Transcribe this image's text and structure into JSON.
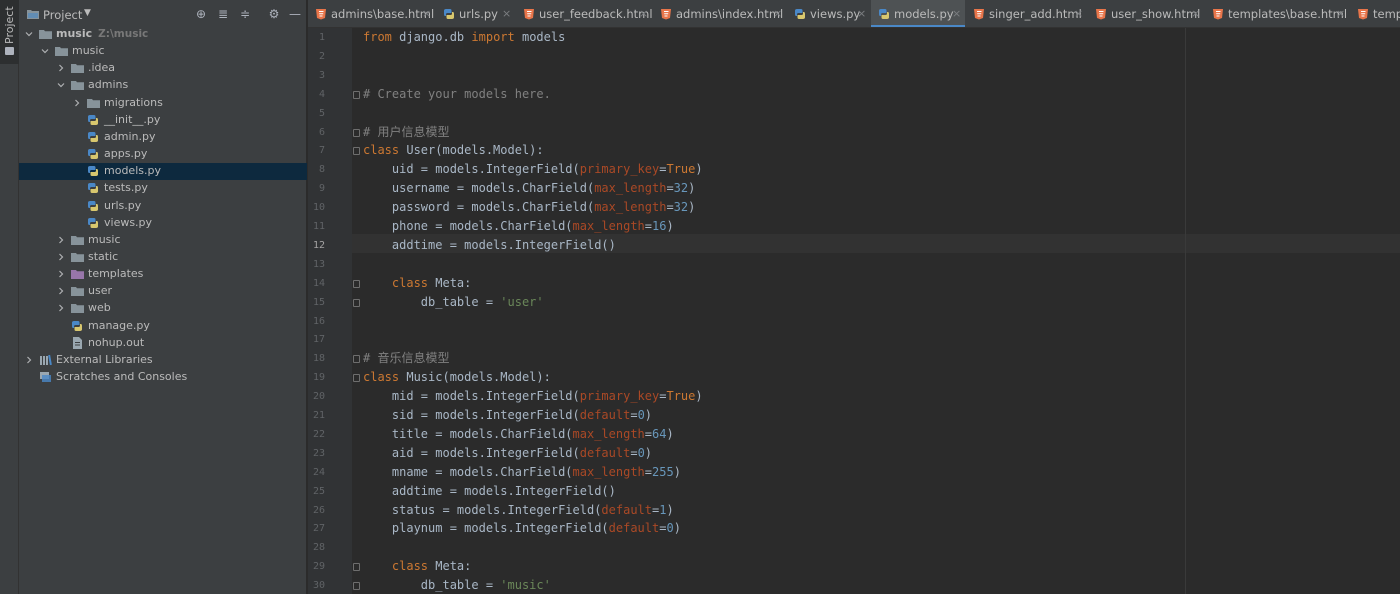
{
  "colors": {
    "keyword": "#cc7832",
    "comment": "#808080",
    "string": "#6a8759",
    "number": "#6897bb",
    "named_param": "#aa4926",
    "text": "#a9b7c6",
    "selection": "#0d293e",
    "active_tab_underline": "#4a88c7",
    "folder_icon": "#87939a",
    "python_icon_blue": "#4a88c7",
    "python_icon_yellow": "#d8c76e"
  },
  "tool_strip": {
    "project_label": "Project"
  },
  "project_panel": {
    "title": "Project",
    "toolbar_icons": [
      "locate-icon",
      "expand-all-icon",
      "collapse-all-icon",
      "gear-icon",
      "minimize-icon"
    ],
    "tree": [
      {
        "label": "music",
        "extra": "Z:\\music",
        "icon": "folder-icon",
        "arrow": "down"
      },
      {
        "label": "music",
        "icon": "folder-icon",
        "arrow": "down"
      },
      {
        "label": ".idea",
        "icon": "folder-icon",
        "arrow": "right"
      },
      {
        "label": "admins",
        "icon": "folder-icon",
        "arrow": "down"
      },
      {
        "label": "migrations",
        "icon": "folder-icon",
        "arrow": "right"
      },
      {
        "label": "__init__.py",
        "icon": "python-file-icon"
      },
      {
        "label": "admin.py",
        "icon": "python-file-icon"
      },
      {
        "label": "apps.py",
        "icon": "python-file-icon"
      },
      {
        "label": "models.py",
        "icon": "python-file-icon",
        "selected": true
      },
      {
        "label": "tests.py",
        "icon": "python-file-icon"
      },
      {
        "label": "urls.py",
        "icon": "python-file-icon"
      },
      {
        "label": "views.py",
        "icon": "python-file-icon"
      },
      {
        "label": "music",
        "icon": "folder-icon",
        "arrow": "right"
      },
      {
        "label": "static",
        "icon": "folder-icon",
        "arrow": "right"
      },
      {
        "label": "templates",
        "icon": "templates-folder-icon",
        "arrow": "right"
      },
      {
        "label": "user",
        "icon": "folder-icon",
        "arrow": "right"
      },
      {
        "label": "web",
        "icon": "folder-icon",
        "arrow": "right"
      },
      {
        "label": "manage.py",
        "icon": "python-file-icon"
      },
      {
        "label": "nohup.out",
        "icon": "text-file-icon"
      },
      {
        "label": "External Libraries",
        "icon": "library-icon",
        "arrow": "right"
      },
      {
        "label": "Scratches and Consoles",
        "icon": "scratches-icon"
      }
    ]
  },
  "tabs": [
    {
      "label": "admins\\base.html",
      "icon": "html-file-icon"
    },
    {
      "label": "urls.py",
      "icon": "python-file-icon"
    },
    {
      "label": "user_feedback.html",
      "icon": "html-file-icon"
    },
    {
      "label": "admins\\index.html",
      "icon": "html-file-icon"
    },
    {
      "label": "views.py",
      "icon": "python-file-icon"
    },
    {
      "label": "models.py",
      "icon": "python-file-icon",
      "active": true
    },
    {
      "label": "singer_add.html",
      "icon": "html-file-icon"
    },
    {
      "label": "user_show.html",
      "icon": "html-file-icon"
    },
    {
      "label": "templates\\base.html",
      "icon": "html-file-icon"
    },
    {
      "label": "templ",
      "icon": "html-file-icon"
    }
  ],
  "editor": {
    "current_line": 12,
    "lines": [
      {
        "n": "1",
        "t": [
          [
            "kw",
            "from"
          ],
          [
            "p",
            " django.db "
          ],
          [
            "kw",
            "import"
          ],
          [
            "p",
            " models"
          ]
        ]
      },
      {
        "n": "2",
        "t": []
      },
      {
        "n": "3",
        "t": []
      },
      {
        "n": "4",
        "t": [
          [
            "cm",
            "# Create your models here."
          ]
        ]
      },
      {
        "n": "5",
        "t": []
      },
      {
        "n": "6",
        "t": [
          [
            "cm",
            "# 用户信息模型"
          ]
        ]
      },
      {
        "n": "7",
        "t": [
          [
            "kw",
            "class"
          ],
          [
            "p",
            " User(models.Model):"
          ]
        ]
      },
      {
        "n": "8",
        "t": [
          [
            "p",
            "    uid = models.IntegerField("
          ],
          [
            "param",
            "primary_key"
          ],
          [
            "p",
            "="
          ],
          [
            "kw",
            "True"
          ],
          [
            "p",
            ")"
          ]
        ]
      },
      {
        "n": "9",
        "t": [
          [
            "p",
            "    username = models.CharField("
          ],
          [
            "param",
            "max_length"
          ],
          [
            "p",
            "="
          ],
          [
            "num",
            "32"
          ],
          [
            "p",
            ")"
          ]
        ]
      },
      {
        "n": "10",
        "t": [
          [
            "p",
            "    password = models.CharField("
          ],
          [
            "param",
            "max_length"
          ],
          [
            "p",
            "="
          ],
          [
            "num",
            "32"
          ],
          [
            "p",
            ")"
          ]
        ]
      },
      {
        "n": "11",
        "t": [
          [
            "p",
            "    phone = models.CharField("
          ],
          [
            "param",
            "max_length"
          ],
          [
            "p",
            "="
          ],
          [
            "num",
            "16"
          ],
          [
            "p",
            ")"
          ]
        ]
      },
      {
        "n": "12",
        "t": [
          [
            "p",
            "    addtime = models.IntegerField()"
          ]
        ]
      },
      {
        "n": "13",
        "t": []
      },
      {
        "n": "14",
        "t": [
          [
            "p",
            "    "
          ],
          [
            "kw",
            "class"
          ],
          [
            "p",
            " Meta:"
          ]
        ]
      },
      {
        "n": "15",
        "t": [
          [
            "p",
            "        db_table = "
          ],
          [
            "str",
            "'user'"
          ]
        ]
      },
      {
        "n": "16",
        "t": []
      },
      {
        "n": "17",
        "t": []
      },
      {
        "n": "18",
        "t": [
          [
            "cm",
            "# 音乐信息模型"
          ]
        ]
      },
      {
        "n": "19",
        "t": [
          [
            "kw",
            "class"
          ],
          [
            "p",
            " Music(models.Model):"
          ]
        ]
      },
      {
        "n": "20",
        "t": [
          [
            "p",
            "    mid = models.IntegerField("
          ],
          [
            "param",
            "primary_key"
          ],
          [
            "p",
            "="
          ],
          [
            "kw",
            "True"
          ],
          [
            "p",
            ")"
          ]
        ]
      },
      {
        "n": "21",
        "t": [
          [
            "p",
            "    sid = models.IntegerField("
          ],
          [
            "param",
            "default"
          ],
          [
            "p",
            "="
          ],
          [
            "num",
            "0"
          ],
          [
            "p",
            ")"
          ]
        ]
      },
      {
        "n": "22",
        "t": [
          [
            "p",
            "    title = models.CharField("
          ],
          [
            "param",
            "max_length"
          ],
          [
            "p",
            "="
          ],
          [
            "num",
            "64"
          ],
          [
            "p",
            ")"
          ]
        ]
      },
      {
        "n": "23",
        "t": [
          [
            "p",
            "    aid = models.IntegerField("
          ],
          [
            "param",
            "default"
          ],
          [
            "p",
            "="
          ],
          [
            "num",
            "0"
          ],
          [
            "p",
            ")"
          ]
        ]
      },
      {
        "n": "24",
        "t": [
          [
            "p",
            "    mname = models.CharField("
          ],
          [
            "param",
            "max_length"
          ],
          [
            "p",
            "="
          ],
          [
            "num",
            "255"
          ],
          [
            "p",
            ")"
          ]
        ]
      },
      {
        "n": "25",
        "t": [
          [
            "p",
            "    addtime = models.IntegerField()"
          ]
        ]
      },
      {
        "n": "26",
        "t": [
          [
            "p",
            "    status = models.IntegerField("
          ],
          [
            "param",
            "default"
          ],
          [
            "p",
            "="
          ],
          [
            "num",
            "1"
          ],
          [
            "p",
            ")"
          ]
        ]
      },
      {
        "n": "27",
        "t": [
          [
            "p",
            "    playnum = models.IntegerField("
          ],
          [
            "param",
            "default"
          ],
          [
            "p",
            "="
          ],
          [
            "num",
            "0"
          ],
          [
            "p",
            ")"
          ]
        ]
      },
      {
        "n": "28",
        "t": []
      },
      {
        "n": "29",
        "t": [
          [
            "p",
            "    "
          ],
          [
            "kw",
            "class"
          ],
          [
            "p",
            " Meta:"
          ]
        ]
      },
      {
        "n": "30",
        "t": [
          [
            "p",
            "        db_table = "
          ],
          [
            "str",
            "'music'"
          ]
        ]
      }
    ]
  }
}
